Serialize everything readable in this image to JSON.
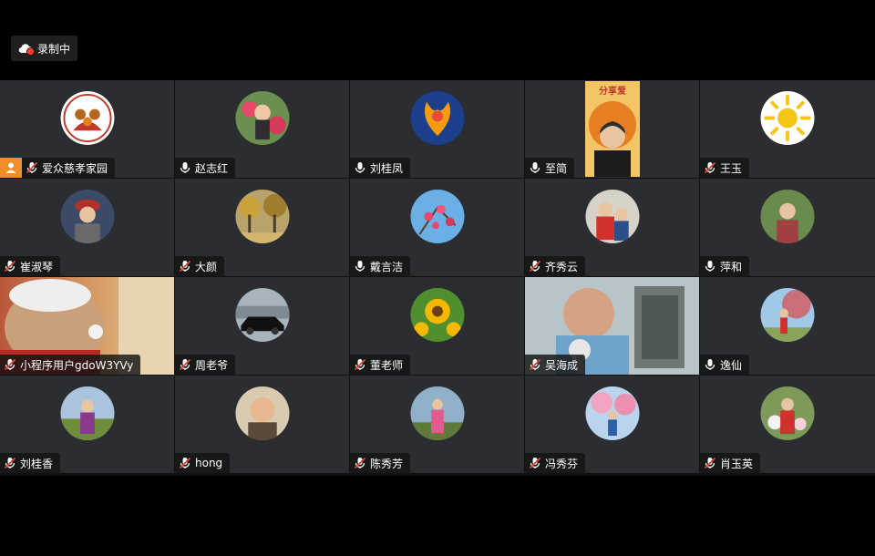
{
  "recording": {
    "label": "录制中",
    "icon": "cloud-record-icon"
  },
  "accent_active": "#21c55d",
  "participants": [
    {
      "name": "爱众慈孝家园",
      "muted": true,
      "host": true,
      "avatar": "logo",
      "logo_text": "爱众慈孝家园"
    },
    {
      "name": "赵志红",
      "muted": false,
      "avatar": "photo-flowers-woman"
    },
    {
      "name": "刘桂凤",
      "muted": false,
      "avatar": "photo-phoenix"
    },
    {
      "name": "至简",
      "muted": false,
      "avatar": "video-speaker",
      "active": true,
      "banner_text": "分享爱"
    },
    {
      "name": "王玉",
      "muted": true,
      "avatar": "sun-drawing"
    },
    {
      "name": "崔淑琴",
      "muted": true,
      "avatar": "photo-woman-red-hat"
    },
    {
      "name": "大颜",
      "muted": true,
      "avatar": "photo-autumn-trees"
    },
    {
      "name": "戴言洁",
      "muted": false,
      "avatar": "photo-blossoms-sky"
    },
    {
      "name": "齐秀云",
      "muted": true,
      "avatar": "photo-family"
    },
    {
      "name": "萍和",
      "muted": false,
      "avatar": "photo-woman-garden"
    },
    {
      "name": "小程序用户gdoW3YVy",
      "muted": true,
      "avatar": "video-man-closeup"
    },
    {
      "name": "周老爷",
      "muted": true,
      "avatar": "photo-black-car"
    },
    {
      "name": "董老师",
      "muted": true,
      "avatar": "photo-sunflowers"
    },
    {
      "name": "吴海成",
      "muted": true,
      "avatar": "video-man-mic"
    },
    {
      "name": "逸仙",
      "muted": false,
      "avatar": "photo-woman-tree"
    },
    {
      "name": "刘桂香",
      "muted": true,
      "avatar": "photo-woman-field"
    },
    {
      "name": "hong",
      "muted": true,
      "avatar": "photo-woman-smiling"
    },
    {
      "name": "陈秀芳",
      "muted": true,
      "avatar": "photo-woman-pink"
    },
    {
      "name": "冯秀芬",
      "muted": true,
      "avatar": "photo-woman-blossom"
    },
    {
      "name": "肖玉英",
      "muted": true,
      "avatar": "photo-woman-flowers"
    }
  ]
}
